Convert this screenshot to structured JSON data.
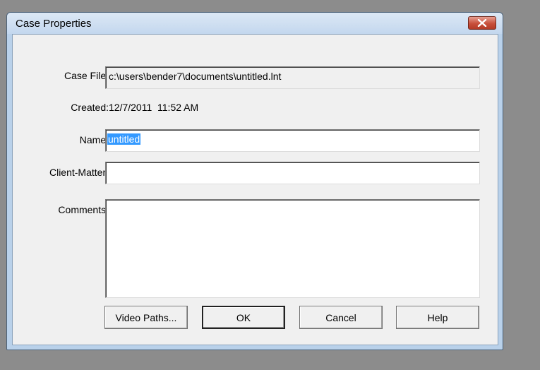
{
  "window": {
    "title": "Case Properties"
  },
  "form": {
    "case_file_label": "Case File:",
    "case_file_value": "c:\\users\\bender7\\documents\\untitled.lnt",
    "created_label": "Created:",
    "created_value": "12/7/2011  11:52 AM",
    "name_label": "Name:",
    "name_value": "untitled",
    "client_matter_label": "Client-Matter:",
    "client_matter_value": "",
    "comments_label": "Comments:",
    "comments_value": ""
  },
  "buttons": {
    "video_paths": "Video Paths...",
    "ok": "OK",
    "cancel": "Cancel",
    "help": "Help"
  },
  "colors": {
    "desktop": "#8c8c8c",
    "title_bar": "#c3d7ee",
    "selection": "#3399ff",
    "close_button": "#c7503b"
  },
  "icons": {
    "close": "close-x-icon",
    "scroll_up": "scroll-up-arrow-icon",
    "scroll_down": "scroll-down-arrow-icon"
  }
}
